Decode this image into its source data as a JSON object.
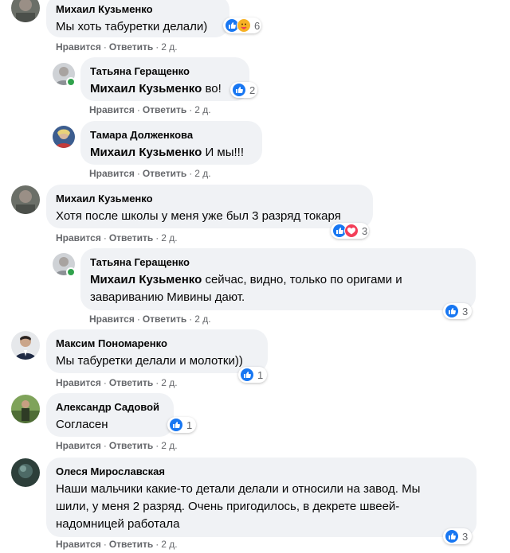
{
  "comments": [
    {
      "author": "Михаил Кузьменко",
      "mention": "",
      "text": "Мы хоть табуретки делали)",
      "reaction_count": "6",
      "reactions": [
        "like",
        "care"
      ],
      "time": "2 д."
    },
    {
      "author": "Татьяна Геращенко",
      "mention": "Михаил Кузьменко",
      "text": " во!",
      "reaction_count": "2",
      "reactions": [
        "like"
      ],
      "time": "2 д."
    },
    {
      "author": "Тамара Долженкова",
      "mention": "Михаил Кузьменко",
      "text": " И мы!!!",
      "reaction_count": "",
      "reactions": [],
      "time": "2 д."
    },
    {
      "author": "Михаил Кузьменко",
      "mention": "",
      "text": "Хотя после школы у меня уже был 3 разряд токаря",
      "reaction_count": "3",
      "reactions": [
        "like",
        "love"
      ],
      "time": "2 д."
    },
    {
      "author": "Татьяна Геращенко",
      "mention": "Михаил Кузьменко",
      "text": " сейчас, видно, только по оригами и завариванию Мивины дают.",
      "reaction_count": "3",
      "reactions": [
        "like"
      ],
      "time": "2 д."
    },
    {
      "author": "Максим Пономаренко",
      "mention": "",
      "text": "Мы табуретки делали и молотки))",
      "reaction_count": "1",
      "reactions": [
        "like"
      ],
      "time": "2 д."
    },
    {
      "author": "Александр Садовой",
      "mention": "",
      "text": "Согласен",
      "reaction_count": "1",
      "reactions": [
        "like"
      ],
      "time": "2 д."
    },
    {
      "author": "Олеся Мирославская",
      "mention": "",
      "text": "Наши мальчики какие-то детали делали и относили на завод. Мы шили, у меня 2 разряд. Очень пригодилось, в декрете швеей-надомницей работала",
      "reaction_count": "3",
      "reactions": [
        "like"
      ],
      "time": "2 д."
    }
  ],
  "actions": {
    "like_label": "Нравится",
    "reply_label": "Ответить",
    "separator": "·"
  },
  "colors": {
    "like": "#1877f2",
    "love": "#f33e58",
    "care": "#f7b125",
    "bubble": "#f0f2f5",
    "meta": "#65676b",
    "online": "#31a24c"
  }
}
